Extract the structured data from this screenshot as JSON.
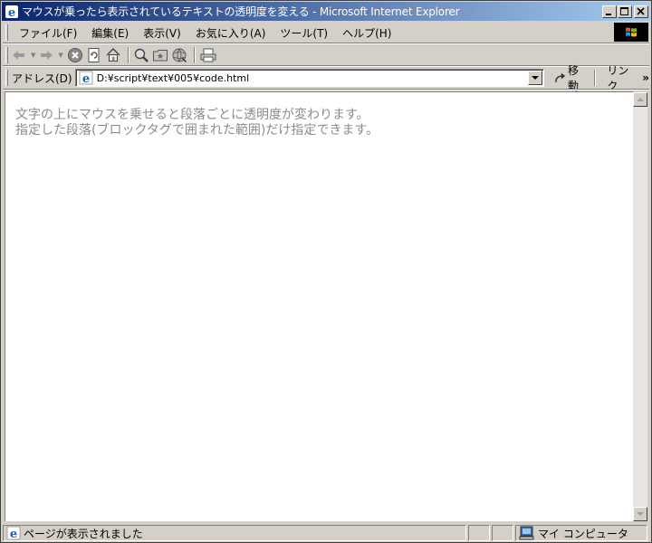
{
  "window": {
    "title": "マウスが乗ったら表示されているテキストの透明度を変える - Microsoft Internet Explorer"
  },
  "menu": {
    "items": [
      {
        "label": "ファイル(F)"
      },
      {
        "label": "編集(E)"
      },
      {
        "label": "表示(V)"
      },
      {
        "label": "お気に入り(A)"
      },
      {
        "label": "ツール(T)"
      },
      {
        "label": "ヘルプ(H)"
      }
    ]
  },
  "toolbar": {
    "buttons": [
      "back-icon",
      "forward-icon",
      "stop-icon",
      "refresh-icon",
      "home-icon",
      "search-icon",
      "favorites-icon",
      "history-icon",
      "print-icon"
    ]
  },
  "address": {
    "label": "アドレス(D)",
    "value": "D:¥script¥text¥005¥code.html",
    "go_label": "移動",
    "links_label": "リンク"
  },
  "page": {
    "paragraphs": [
      "文字の上にマウスを乗せると段落ごとに透明度が変わります。",
      "指定した段落(ブロックタグで囲まれた範囲)だけ指定できます。"
    ],
    "text_color": "#8c8c8c"
  },
  "status": {
    "message": "ページが表示されました",
    "zone": "マイ コンピュータ"
  }
}
